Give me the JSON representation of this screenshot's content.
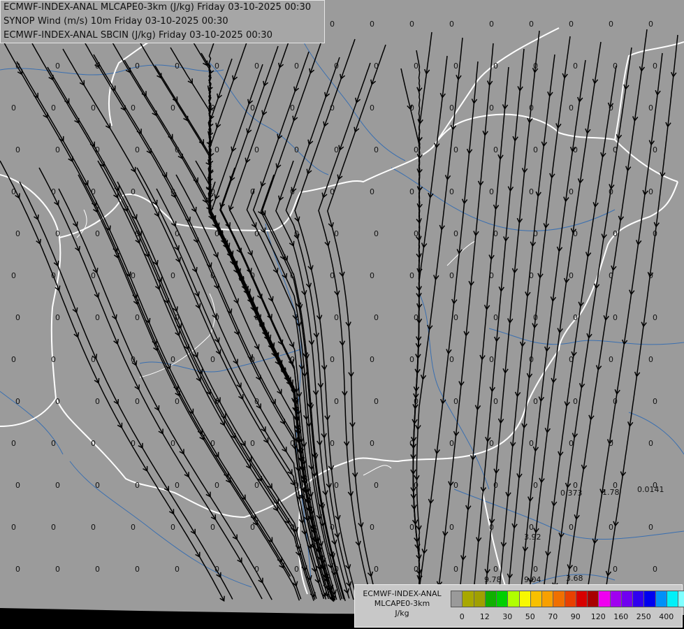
{
  "header": {
    "line1": "ECMWF-INDEX-ANAL MLCAPE0-3km (J/kg) Friday 03-10-2025 00:30",
    "line2": "SYNOP Wind (m/s) 10m Friday 03-10-2025 00:30",
    "line3": "ECMWF-INDEX-ANAL SBCIN (J/kg) Friday 03-10-2025 00:30"
  },
  "legend": {
    "title_lines": [
      "ECMWF-INDEX-ANAL",
      "MLCAPE0-3km",
      "J/kg"
    ],
    "colors": [
      "#9a9a9a",
      "#a8a800",
      "#a0a000",
      "#10b000",
      "#00d000",
      "#b0ff00",
      "#f8f800",
      "#f8c000",
      "#f8a000",
      "#f07000",
      "#e84000",
      "#d80000",
      "#a80000",
      "#f000f0",
      "#a000f0",
      "#7000f0",
      "#3000f0",
      "#0000f0",
      "#0090f8",
      "#00f0f8",
      "#80ffff",
      "#ffffff"
    ],
    "tick_labels": [
      "0",
      "12",
      "30",
      "50",
      "70",
      "90",
      "120",
      "160",
      "250",
      "400"
    ]
  },
  "map_values": {
    "nonzero": [
      {
        "label": "9.78"
      },
      {
        "label": "9.04"
      },
      {
        "label": "3.68"
      },
      {
        "label": "0.373"
      },
      {
        "label": "1.78"
      },
      {
        "label": "0.0141"
      },
      {
        "label": "3.92"
      }
    ],
    "zero_label": "0"
  },
  "colors": {
    "land": "#9b9b9b",
    "border": "#ffffff",
    "rivers": "#3a6fb0",
    "streamlines": "#000000",
    "sea_band": "#000000"
  }
}
